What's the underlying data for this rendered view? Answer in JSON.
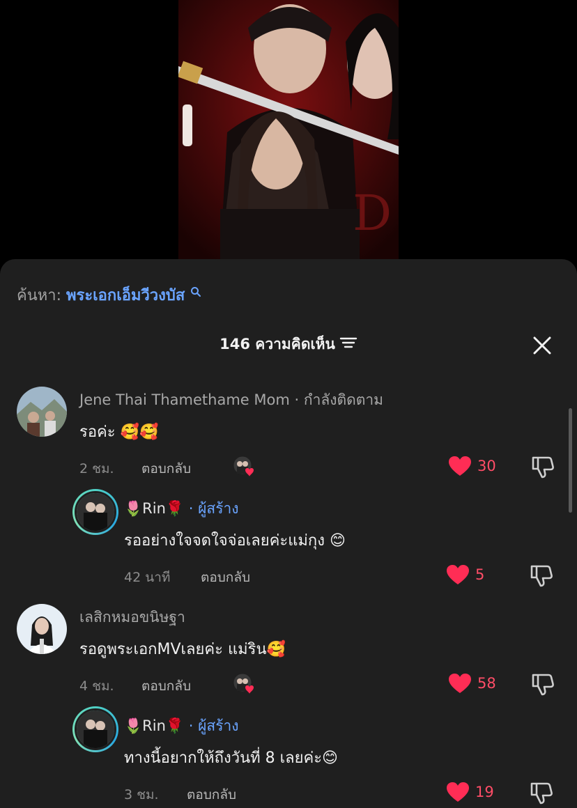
{
  "search": {
    "prefix": "ค้นหา:",
    "term": "พระเอกเอ็มวีวงบัส",
    "icon": "search-icon"
  },
  "header": {
    "comment_count": "146 ความคิดเห็น",
    "sort_icon": "sort-icon",
    "close_icon": "close-icon"
  },
  "comments": [
    {
      "author": "Jene Thai Thamethame Mom",
      "follow_status": "· กำลังติดตาม",
      "text": "รอค่ะ 🥰🥰",
      "time": "2 ชม.",
      "reply_label": "ตอบกลับ",
      "likes": "30",
      "liked_by_creator": true,
      "reply": {
        "author": "🌷Rin🌹",
        "badge": "· ผู้สร้าง",
        "text": "รออย่างใจจดใจจ่อเลยค่ะแม่กุง 😊",
        "time": "42 นาที",
        "reply_label": "ตอบกลับ",
        "likes": "5"
      }
    },
    {
      "author": "เลสิกหมอขนิษฐา",
      "follow_status": "",
      "text": "รอดูพระเอกMVเลยค่ะ แม่ริน🥰",
      "time": "4 ชม.",
      "reply_label": "ตอบกลับ",
      "likes": "58",
      "liked_by_creator": true,
      "reply": {
        "author": "🌷Rin🌹",
        "badge": "· ผู้สร้าง",
        "text": "ทางนี้อยากให้ถึงวันที่ 8 เลยค่ะ😊",
        "time": "3 ชม.",
        "reply_label": "ตอบกลับ",
        "likes": "19"
      }
    }
  ],
  "colors": {
    "sheet_bg": "#1f1f1f",
    "link_blue": "#6aa4ff",
    "like_red": "#ff4d67"
  }
}
